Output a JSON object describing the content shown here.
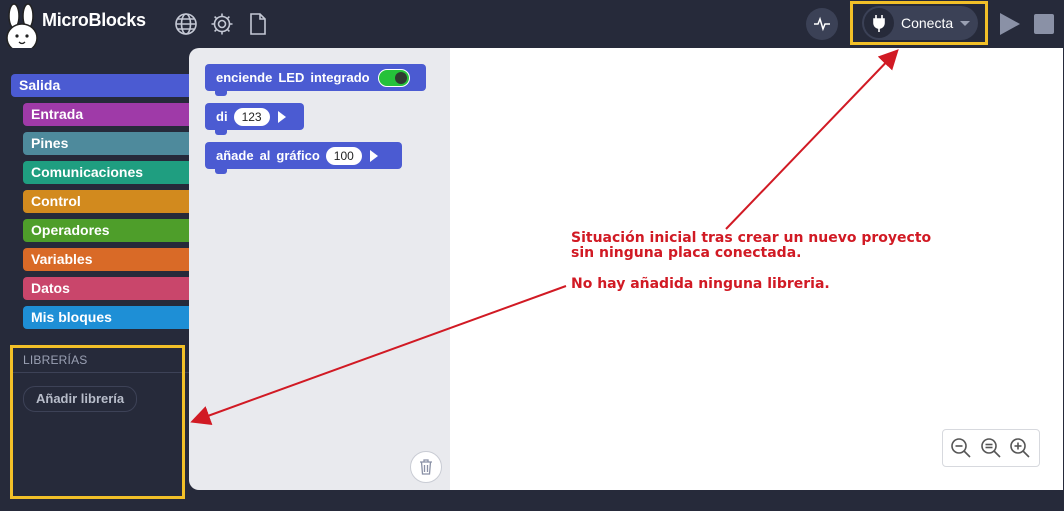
{
  "app": {
    "title": "MicroBlocks"
  },
  "toolbar": {
    "connect_label": "Conecta",
    "icons": [
      "globe-icon",
      "gear-icon",
      "file-icon",
      "graph-icon",
      "plug-icon",
      "play-icon",
      "stop-icon"
    ]
  },
  "sidebar": {
    "categories": [
      {
        "label": "Salida",
        "color": "#4b5bd2"
      },
      {
        "label": "Entrada",
        "color": "#9f3aa8"
      },
      {
        "label": "Pines",
        "color": "#4e8a9c"
      },
      {
        "label": "Comunicaciones",
        "color": "#1f9e80"
      },
      {
        "label": "Control",
        "color": "#d28a1e"
      },
      {
        "label": "Operadores",
        "color": "#4e9e2a"
      },
      {
        "label": "Variables",
        "color": "#d96a27"
      },
      {
        "label": "Datos",
        "color": "#c9466b"
      },
      {
        "label": "Mis bloques",
        "color": "#1e8fd6"
      }
    ],
    "libraries_header": "LIBRERÍAS",
    "add_library_label": "Añadir librería"
  },
  "palette": {
    "blocks": [
      {
        "words": [
          "enciende",
          "LED",
          "integrado"
        ],
        "toggle": true
      },
      {
        "words": [
          "di"
        ],
        "slot": "123",
        "arrow": true
      },
      {
        "words": [
          "añade",
          "al",
          "gráfico"
        ],
        "slot": "100",
        "arrow": true
      }
    ]
  },
  "annotations": {
    "line1": "Situación inicial tras crear un nuevo proyecto",
    "line2": "sin ninguna placa conectada.",
    "line3": "No hay añadida ninguna libreria."
  },
  "colors": {
    "highlight": "#f2c028",
    "annotation": "#d11a24",
    "topbar": "#262a3a"
  }
}
